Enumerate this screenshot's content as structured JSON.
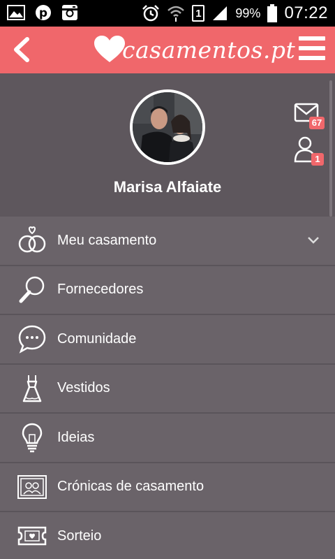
{
  "status_bar": {
    "battery_percent": "99%",
    "time": "07:22",
    "sim_slot": "1",
    "icons": [
      "gallery-icon",
      "pinterest-icon",
      "instagram-icon",
      "alarm-icon",
      "wifi-icon",
      "signal-icon",
      "battery-icon"
    ]
  },
  "app_bar": {
    "logo_text": "casamentos.pt",
    "brand_color": "#f0676b"
  },
  "profile": {
    "name": "Marisa Alfaiate",
    "messages_count": "67",
    "friend_requests_count": "1"
  },
  "menu": {
    "items": [
      {
        "label": "Meu casamento",
        "icon": "rings-icon"
      },
      {
        "label": "Fornecedores",
        "icon": "magnifier-icon"
      },
      {
        "label": "Comunidade",
        "icon": "chat-bubble-icon"
      },
      {
        "label": "Vestidos",
        "icon": "dress-icon"
      },
      {
        "label": "Ideias",
        "icon": "lightbulb-icon"
      },
      {
        "label": "Crónicas de casamento",
        "icon": "photo-album-icon"
      },
      {
        "label": "Sorteio",
        "icon": "ticket-icon"
      }
    ]
  }
}
